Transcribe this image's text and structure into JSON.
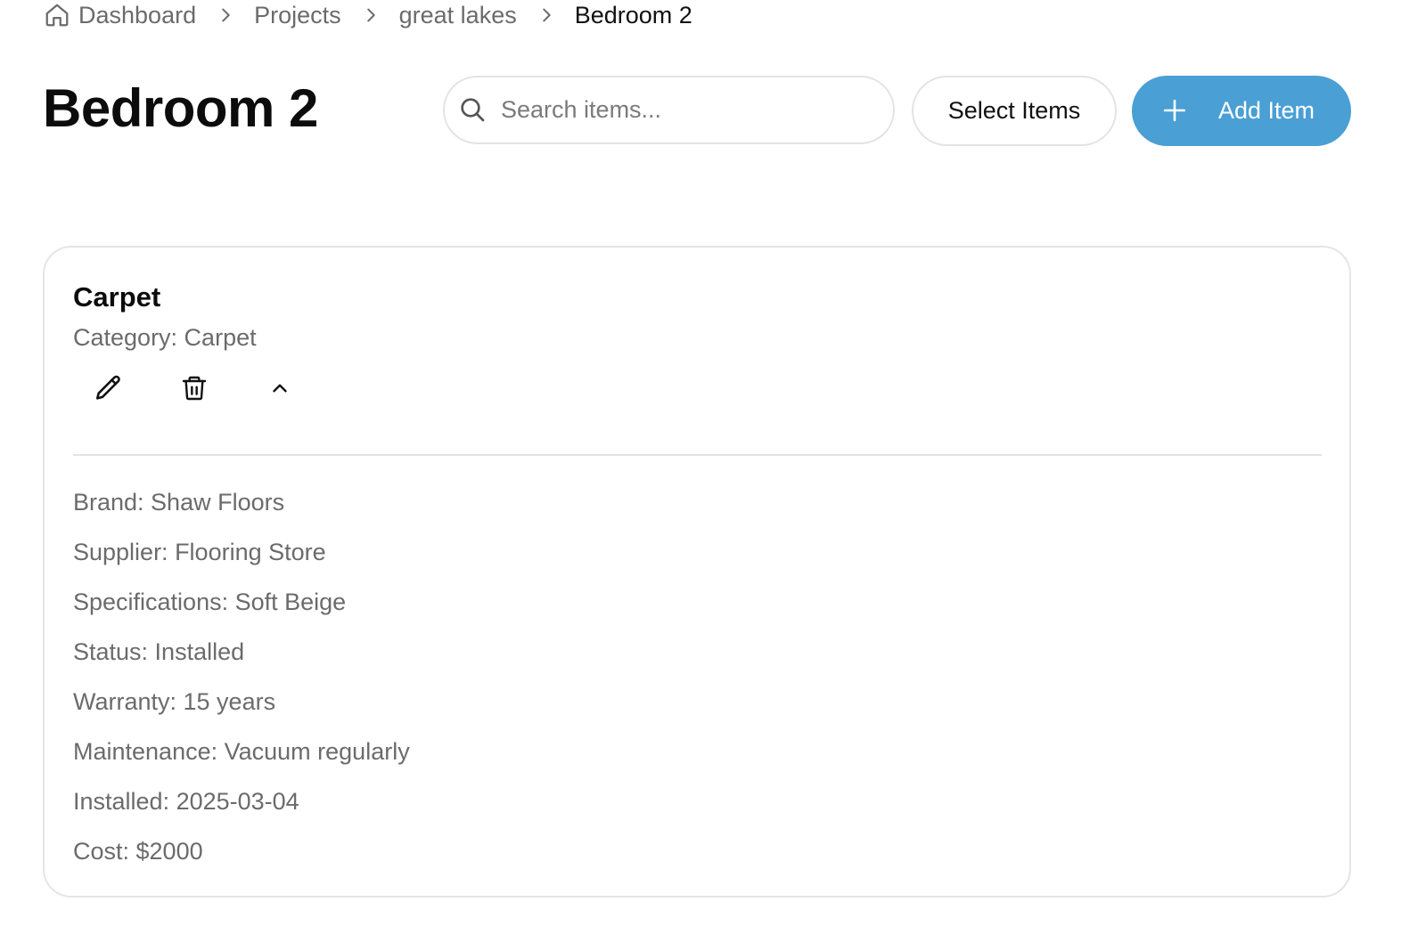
{
  "breadcrumb": {
    "items": [
      {
        "label": "Dashboard",
        "icon": "home-icon"
      },
      {
        "label": "Projects"
      },
      {
        "label": "great lakes"
      },
      {
        "label": "Bedroom 2",
        "current": true
      }
    ],
    "separator_icon": "chevron-right-icon"
  },
  "page": {
    "title": "Bedroom 2"
  },
  "search": {
    "placeholder": "Search items...",
    "value": "",
    "icon": "search-icon"
  },
  "toolbar": {
    "select_label": "Select Items",
    "add_label": "Add Item",
    "add_icon": "plus-icon",
    "accent_color": "#4a9fd4"
  },
  "item": {
    "name": "Carpet",
    "category": "Category: Carpet",
    "actions": [
      "pencil-icon",
      "trash-icon",
      "chevron-up-icon"
    ],
    "details": [
      "Brand: Shaw Floors",
      "Supplier: Flooring Store",
      "Specifications: Soft Beige",
      "Status: Installed",
      "Warranty: 15 years",
      "Maintenance: Vacuum regularly",
      "Installed: 2025-03-04",
      "Cost: $2000"
    ]
  }
}
